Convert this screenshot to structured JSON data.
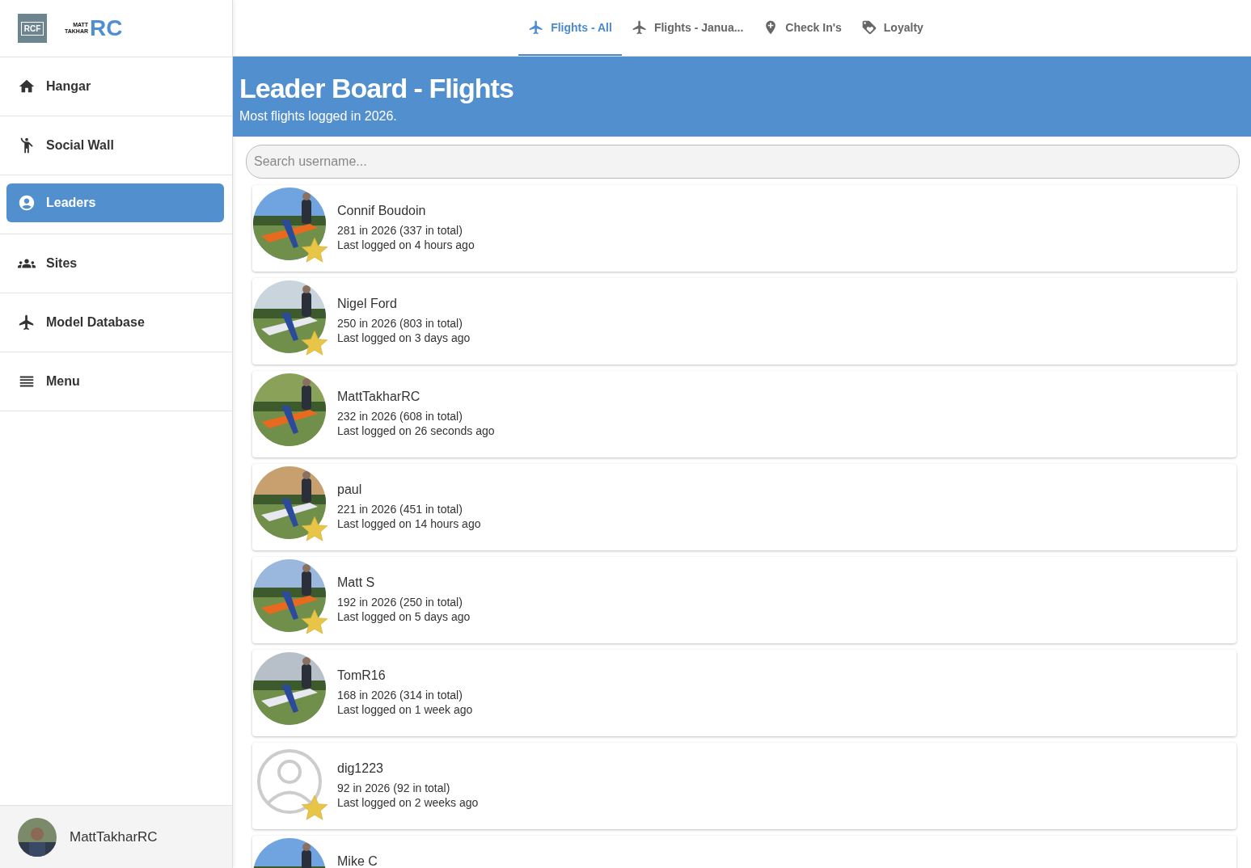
{
  "logos": [
    {
      "kind": "rcf",
      "text": "RCF"
    },
    {
      "kind": "mtrc",
      "line1": "MATT",
      "line2": "TAKHAR",
      "mark": "RC"
    }
  ],
  "sidebar": {
    "items": [
      {
        "label": "Hangar",
        "selected": false
      },
      {
        "label": "Social Wall",
        "selected": false
      },
      {
        "label": "Leaders",
        "selected": true
      },
      {
        "label": "Sites",
        "selected": false
      },
      {
        "label": "Model Database",
        "selected": false
      },
      {
        "label": "Menu",
        "selected": false
      }
    ],
    "user": {
      "name": "MattTakharRC"
    }
  },
  "tabs": [
    {
      "label": "Flights - All",
      "selected": true
    },
    {
      "label": "Flights - Janua...",
      "selected": false
    },
    {
      "label": "Check In's",
      "selected": false
    },
    {
      "label": "Loyalty",
      "selected": false
    }
  ],
  "banner": {
    "title": "Leader Board - Flights",
    "subtitle": "Most flights logged in 2026."
  },
  "search": {
    "placeholder": "Search username..."
  },
  "leaders": [
    {
      "name": "Connif Boudoin",
      "count": "281 in 2026 (337 in total)",
      "last": "Last logged on 4 hours ago",
      "star": true
    },
    {
      "name": "Nigel Ford",
      "count": "250 in 2026 (803 in total)",
      "last": "Last logged on 3 days ago",
      "star": true
    },
    {
      "name": "MattTakharRC",
      "count": "232 in 2026 (608 in total)",
      "last": "Last logged on 26 seconds ago",
      "star": false
    },
    {
      "name": "paul",
      "count": "221 in 2026 (451 in total)",
      "last": "Last logged on 14 hours ago",
      "star": true
    },
    {
      "name": "Matt S",
      "count": "192 in 2026 (250 in total)",
      "last": "Last logged on 5 days ago",
      "star": true
    },
    {
      "name": "TomR16",
      "count": "168 in 2026 (314 in total)",
      "last": "Last logged on 1 week ago",
      "star": false
    },
    {
      "name": "dig1223",
      "count": "92 in 2026 (92 in total)",
      "last": "Last logged on 2 weeks ago",
      "kind": "placeholder",
      "star": true
    },
    {
      "name": "Mike C"
    }
  ]
}
